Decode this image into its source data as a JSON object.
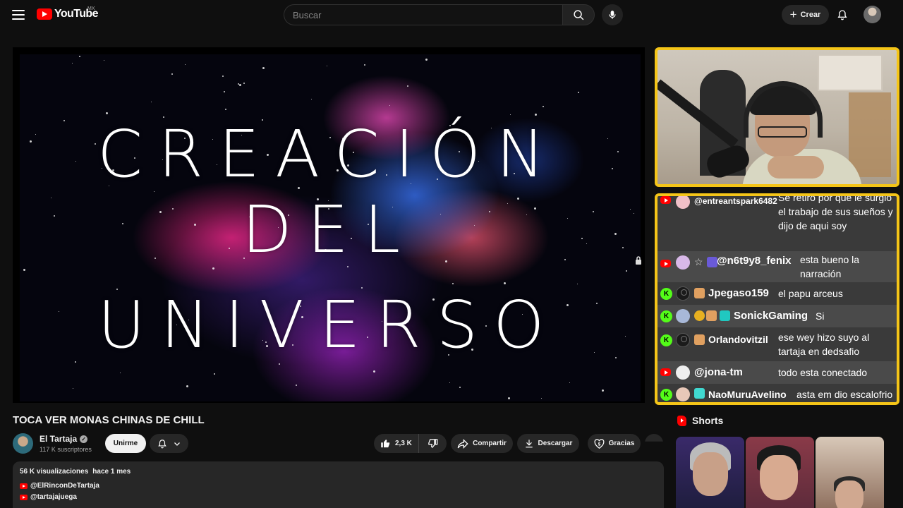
{
  "header": {
    "logo_text": "YouTube",
    "country_code": "MX",
    "search_placeholder": "Buscar",
    "create_label": "Crear"
  },
  "video": {
    "title_lines": [
      "CREACIÓN",
      "DEL",
      "UNIVERSO"
    ],
    "title": "TOCA VER MONAS CHINAS DE CHILL"
  },
  "channel": {
    "name": "El Tartaja",
    "subscribers": "117 K suscriptores",
    "join_label": "Unirme"
  },
  "actions": {
    "likes": "2,3 K",
    "share_label": "Compartir",
    "download_label": "Descargar",
    "thanks_label": "Gracias"
  },
  "description": {
    "views": "56 K visualizaciones",
    "date": "hace 1 mes",
    "links": [
      "@ElRinconDeTartaja",
      "@tartajajuega"
    ]
  },
  "chat": {
    "messages": [
      {
        "platform": "youtube",
        "user": "@entreantspark6482",
        "message": "Se retiro por que le surgio el trabajo de sus sueños y dijo de aqui soy"
      },
      {
        "platform": "youtube",
        "user": "@n6t9y8_fenix",
        "message": "esta bueno la narración"
      },
      {
        "platform": "kick",
        "user": "Jpegaso159",
        "message": "el papu arceus"
      },
      {
        "platform": "kick",
        "user": "SonickGaming",
        "message": "Si"
      },
      {
        "platform": "kick",
        "user": "Orlandovitzil",
        "message": "ese wey hizo suyo al tartaja en dedsafio"
      },
      {
        "platform": "youtube",
        "user": "@jona-tm",
        "message": "todo esta conectado"
      },
      {
        "platform": "kick",
        "user": "NaoMuruAvelino",
        "message": "asta em dio escalofrio"
      }
    ]
  },
  "shorts": {
    "heading": "Shorts"
  },
  "colors": {
    "accent": "#ff0000",
    "overlay_border": "#f5c518",
    "kick_green": "#53fc18",
    "background": "#0f0f0f"
  }
}
